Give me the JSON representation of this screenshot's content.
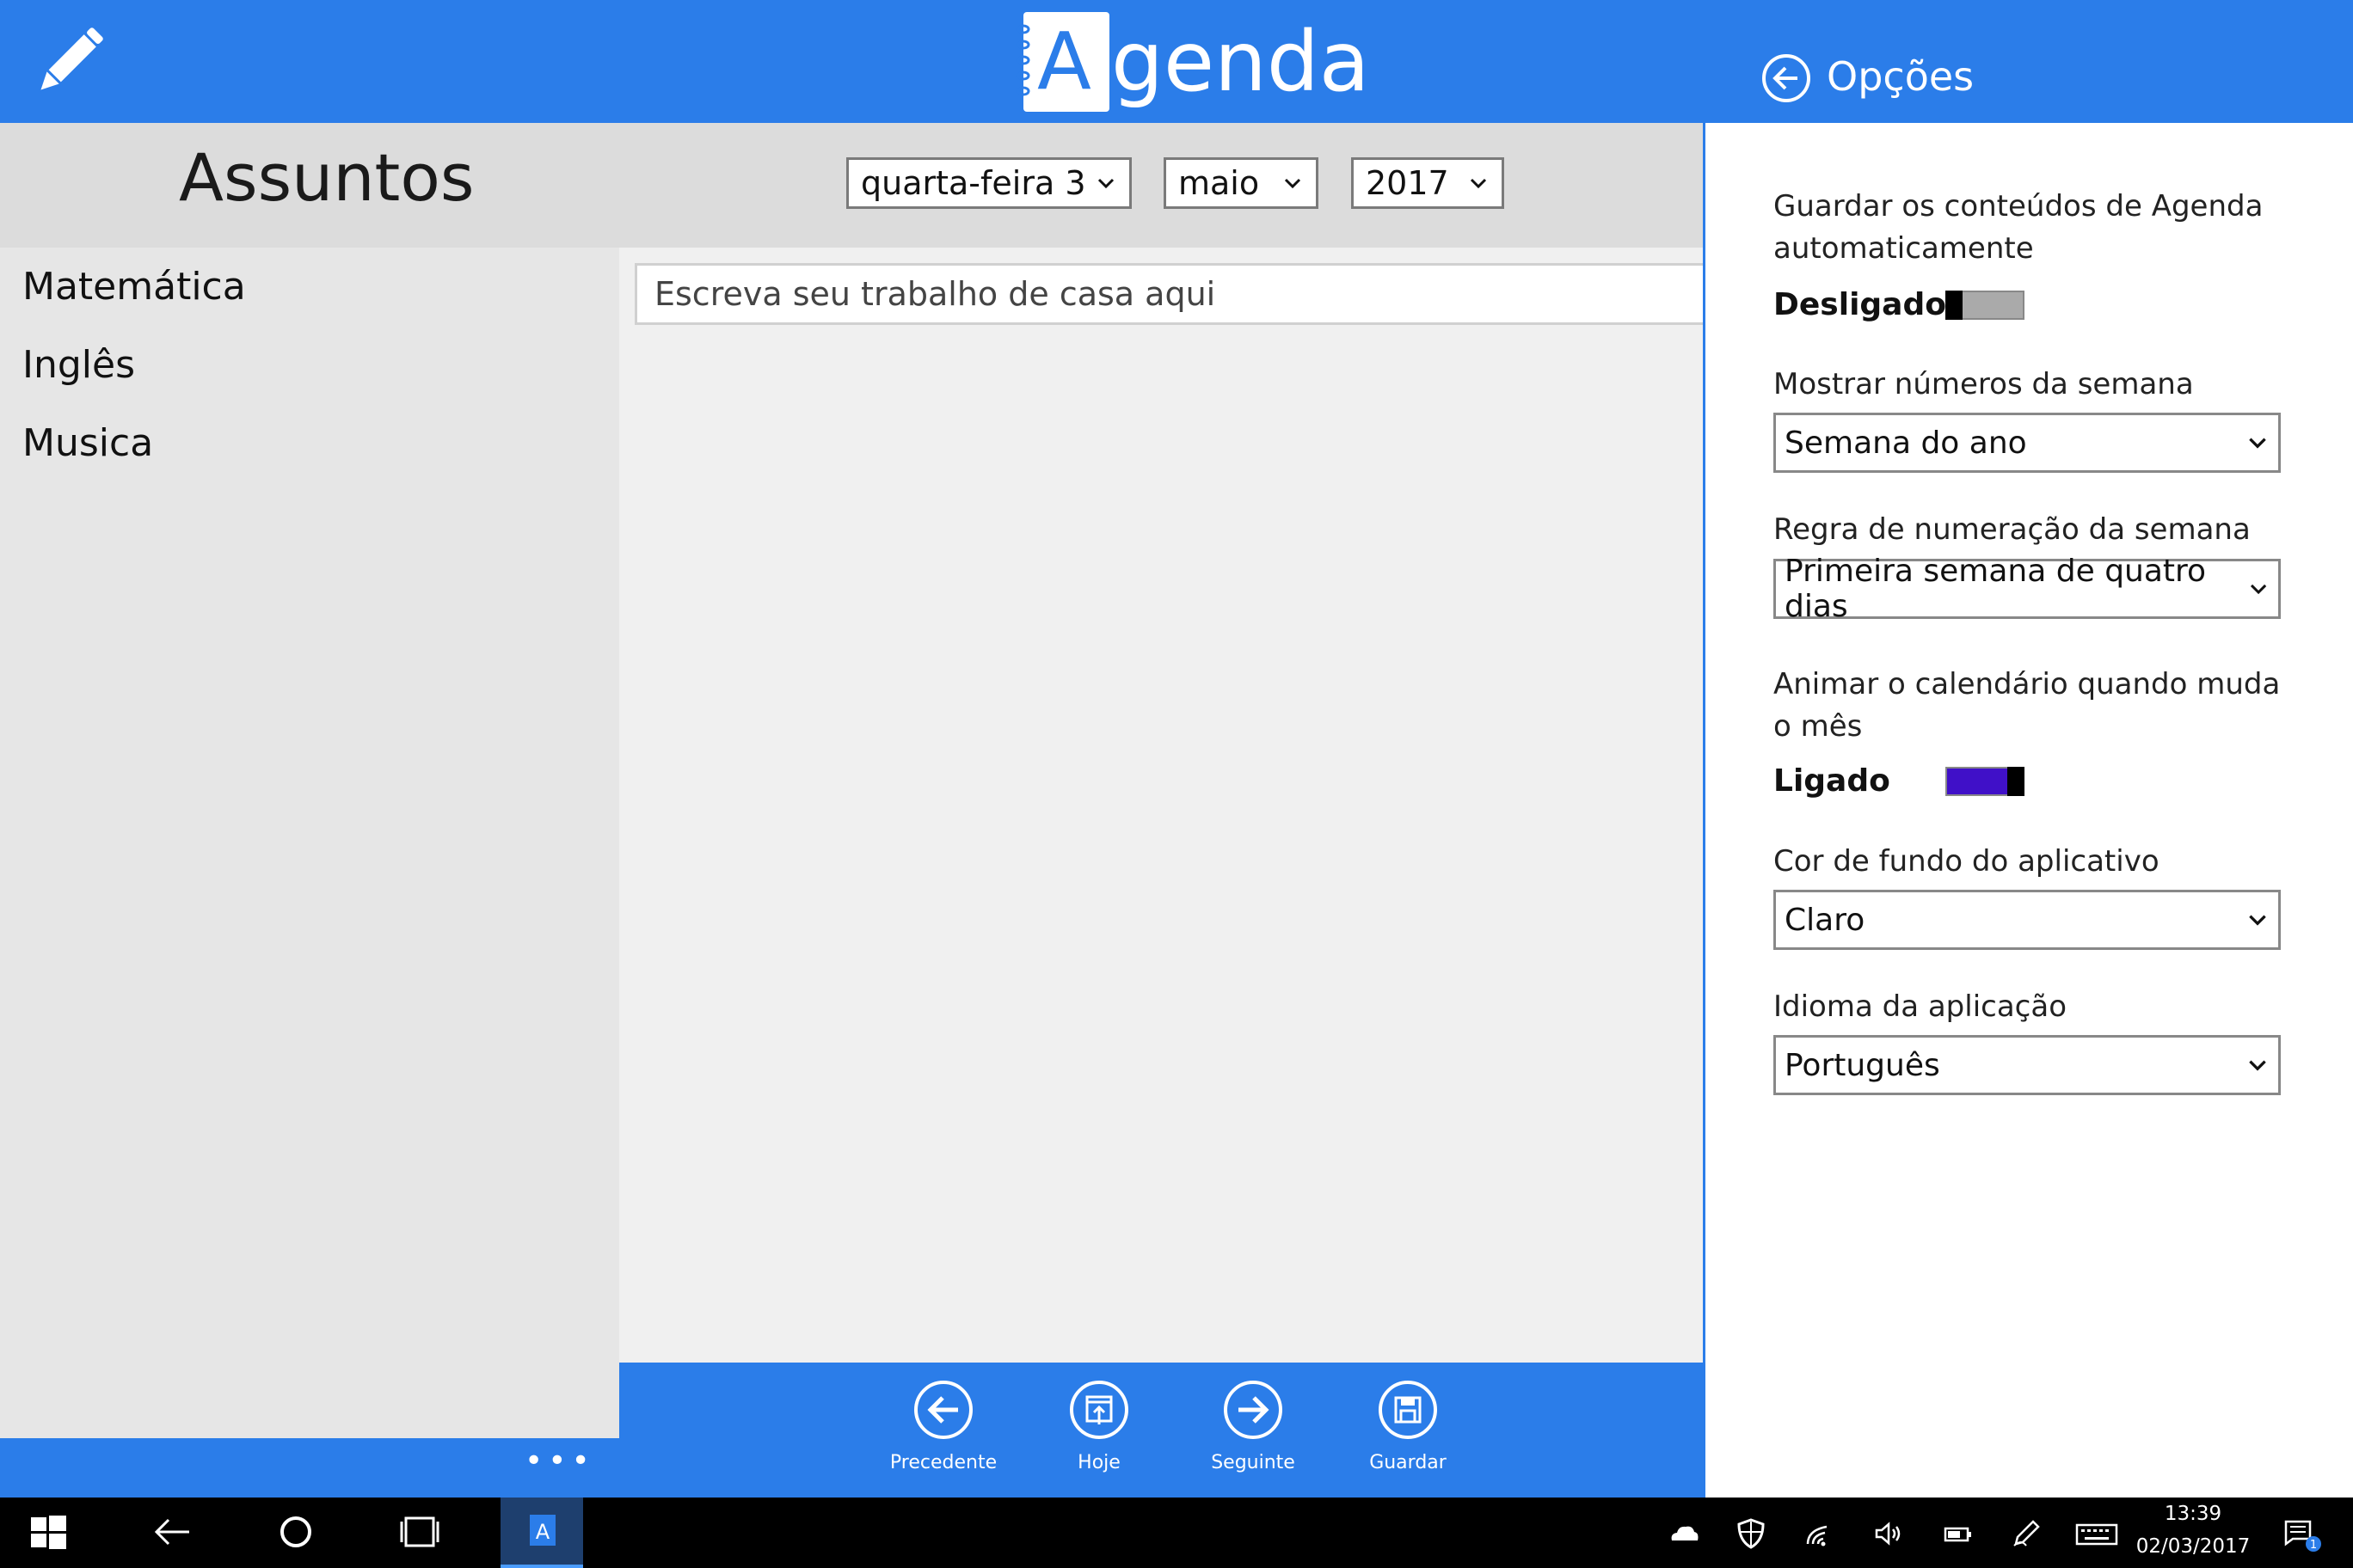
{
  "app": {
    "logo_letter": "A",
    "logo_rest": "genda",
    "subjects_title": "Assuntos",
    "date": {
      "day": "quarta-feira 3",
      "month": "maio",
      "year": "2017"
    },
    "subjects": [
      "Matemática",
      "Inglês",
      "Musica"
    ],
    "homework_placeholder": "Escreva seu trabalho de casa aqui",
    "more_label": "•••",
    "commands": [
      {
        "label": "Precedente",
        "icon": "arrow-left-icon"
      },
      {
        "label": "Hoje",
        "icon": "today-icon"
      },
      {
        "label": "Seguinte",
        "icon": "arrow-right-icon"
      },
      {
        "label": "Guardar",
        "icon": "save-icon"
      }
    ],
    "accent": "#2b7de9"
  },
  "options": {
    "title": "Opções",
    "autosave": {
      "label": "Guardar os conteúdos de Agenda automaticamente",
      "state": "Desligado",
      "on": false
    },
    "week_numbers": {
      "label": "Mostrar números da semana",
      "value": "Semana do ano"
    },
    "week_rule": {
      "label": "Regra de numeração da semana",
      "value": "Primeira semana de quatro dias"
    },
    "animate": {
      "label": "Animar o calendário quando muda o mês",
      "state": "Ligado",
      "on": true
    },
    "background": {
      "label": "Cor de fundo do aplicativo",
      "value": "Claro"
    },
    "language": {
      "label": "Idioma da aplicação",
      "value": "Português"
    },
    "toggle_on_color": "#4010c8"
  },
  "taskbar": {
    "time": "13:39",
    "date": "02/03/2017",
    "notification_count": "1"
  }
}
